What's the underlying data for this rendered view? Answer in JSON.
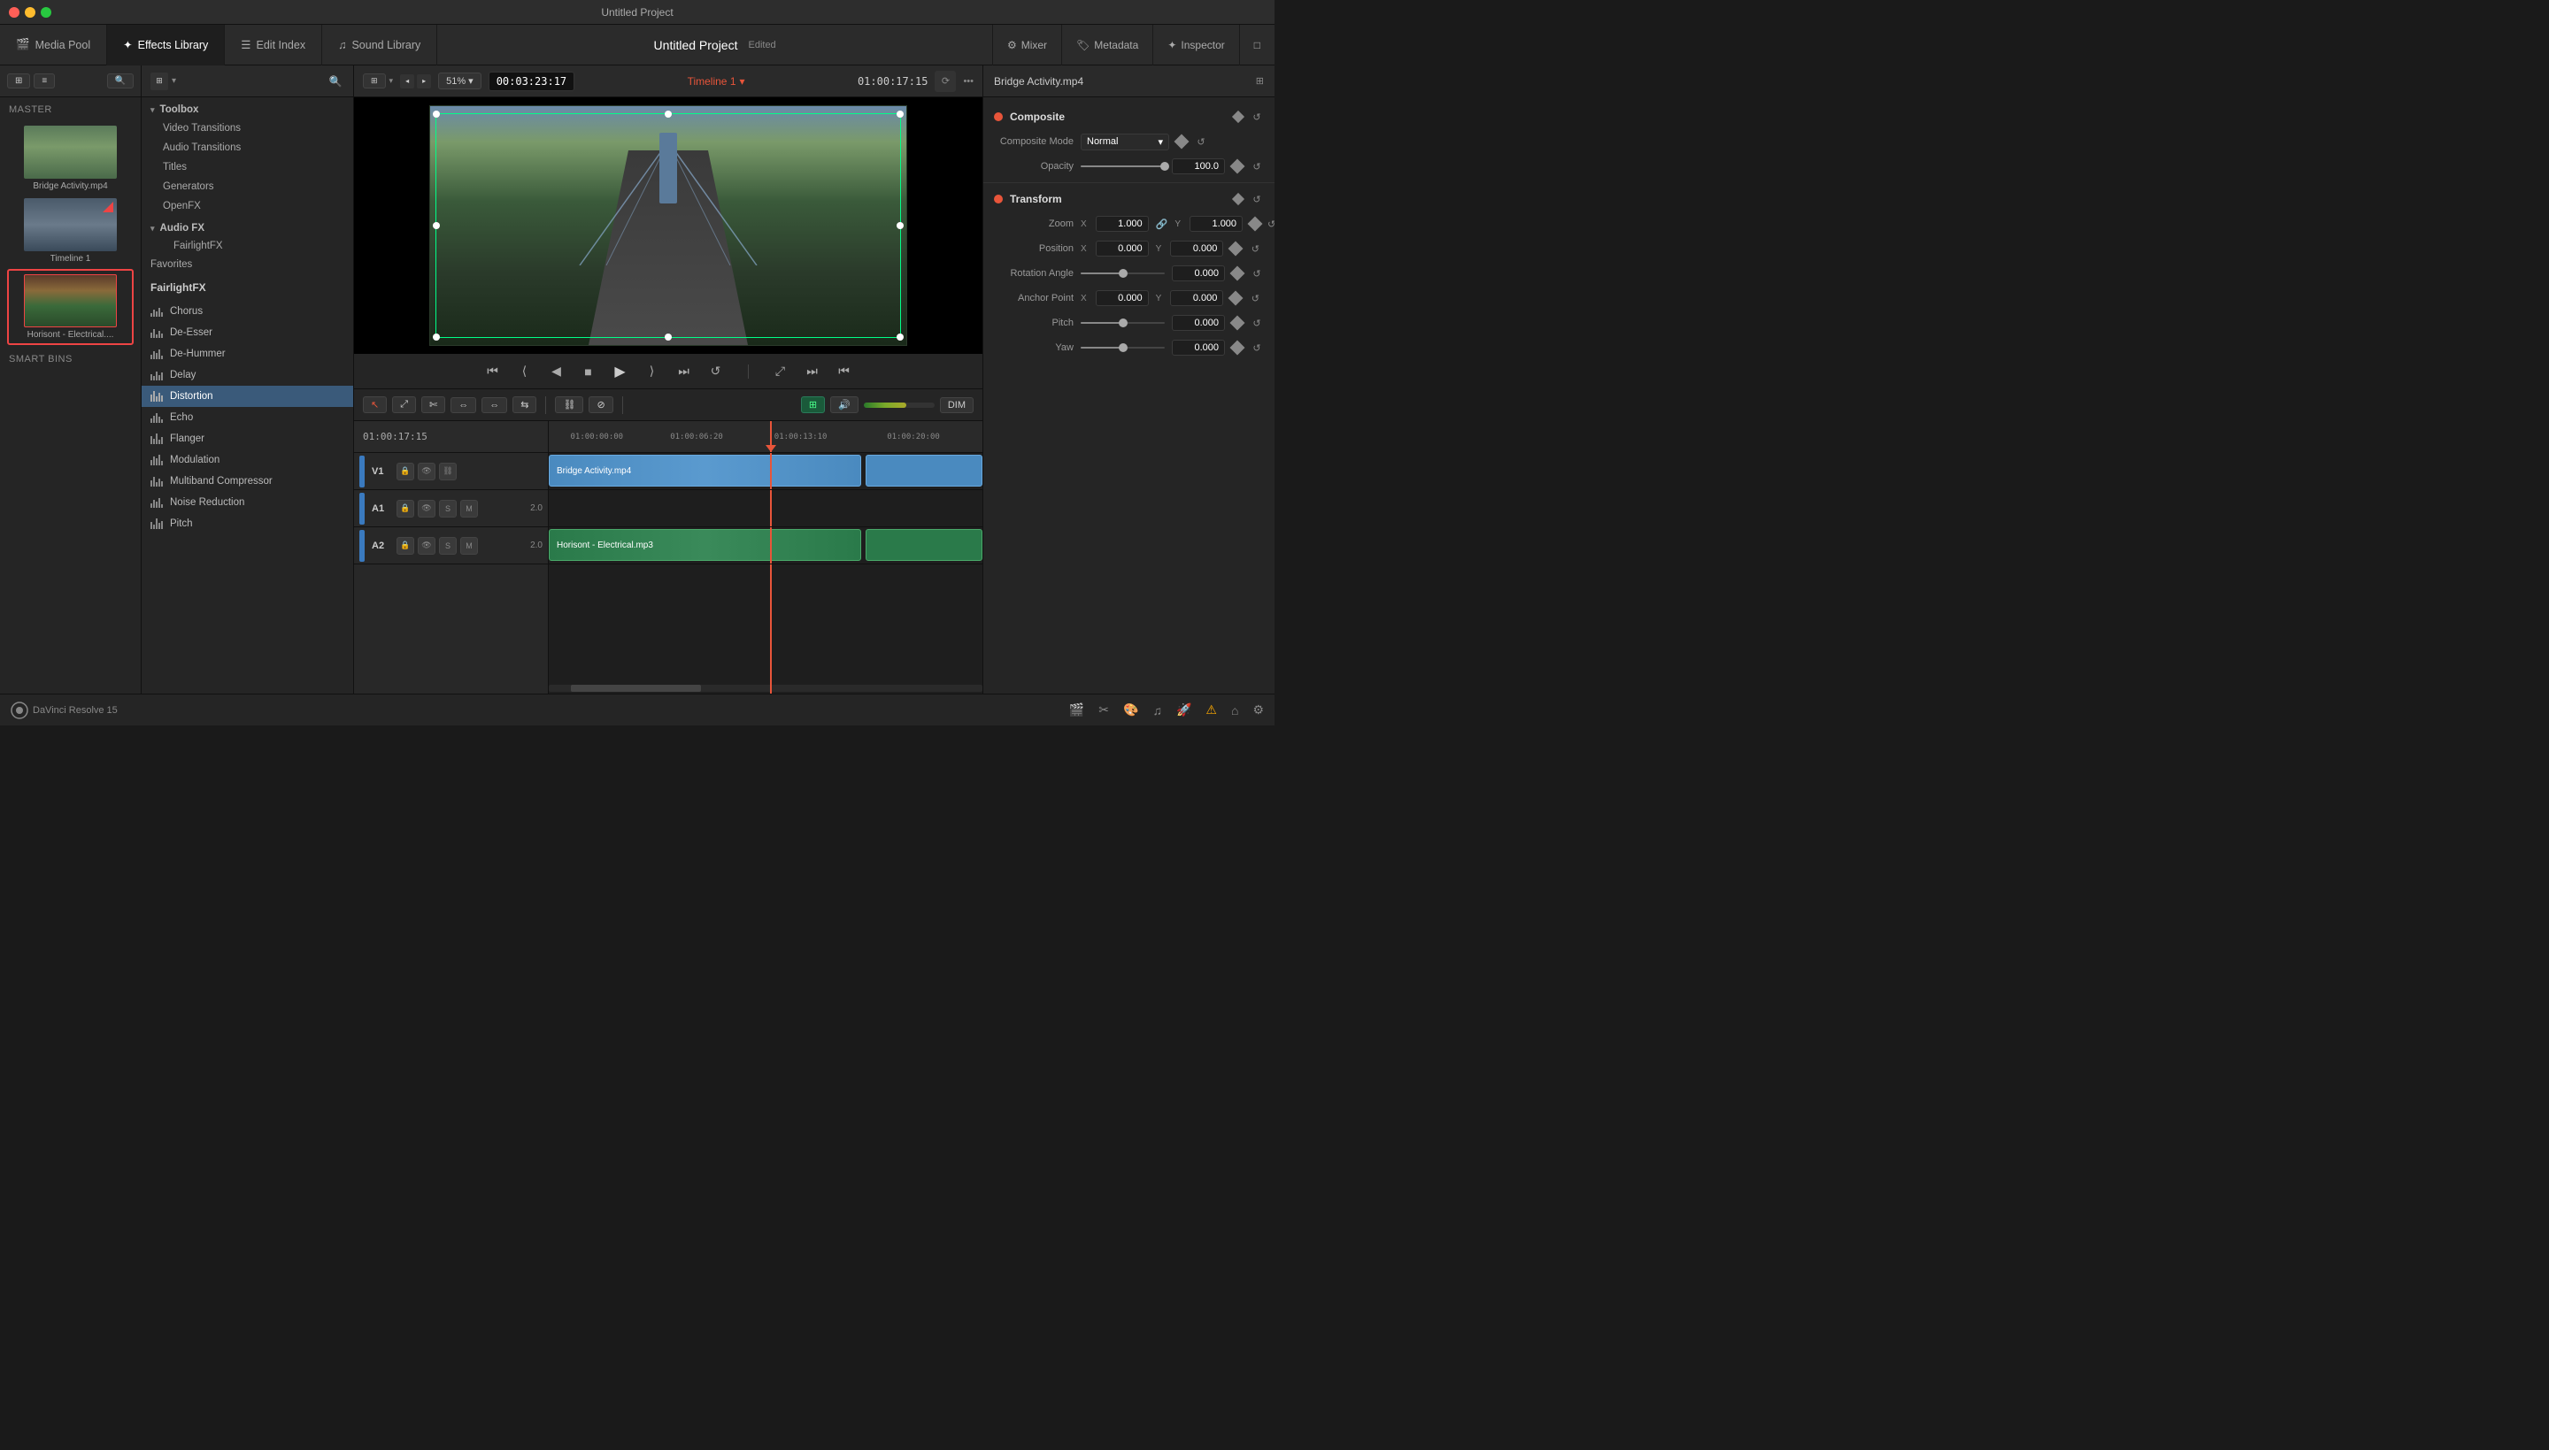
{
  "window": {
    "title": "Untitled Project"
  },
  "nav": {
    "tabs": [
      {
        "id": "media-pool",
        "icon": "🎬",
        "label": "Media Pool",
        "active": false
      },
      {
        "id": "effects-library",
        "icon": "✨",
        "label": "Effects Library",
        "active": true
      },
      {
        "id": "edit-index",
        "icon": "📋",
        "label": "Edit Index",
        "active": false
      },
      {
        "id": "sound-library",
        "icon": "🎵",
        "label": "Sound Library",
        "active": false
      }
    ],
    "project_title": "Untitled Project",
    "project_status": "Edited",
    "timeline_name": "Timeline 1",
    "actions": [
      {
        "id": "mixer",
        "label": "Mixer"
      },
      {
        "id": "metadata",
        "label": "Metadata"
      },
      {
        "id": "inspector",
        "label": "Inspector"
      }
    ]
  },
  "media_pool": {
    "master_label": "Master",
    "smart_bins_label": "Smart Bins",
    "items": [
      {
        "id": "bridge",
        "label": "Bridge Activity.mp4",
        "type": "video"
      },
      {
        "id": "timeline1",
        "label": "Timeline 1",
        "type": "timeline"
      },
      {
        "id": "horisont",
        "label": "Horisont - Electrical....",
        "type": "audio"
      }
    ]
  },
  "effects": {
    "panel_title": "FairlightFX",
    "toolbox": {
      "label": "Toolbox",
      "items": [
        {
          "id": "video-transitions",
          "label": "Video Transitions"
        },
        {
          "id": "audio-transitions",
          "label": "Audio Transitions"
        },
        {
          "id": "titles",
          "label": "Titles"
        },
        {
          "id": "generators",
          "label": "Generators"
        }
      ],
      "openfx_label": "OpenFX",
      "audio_fx_label": "Audio FX",
      "fairlightfx_label": "FairlightFX",
      "favorites_label": "Favorites"
    },
    "list": [
      {
        "id": "chorus",
        "label": "Chorus",
        "active": false
      },
      {
        "id": "de-esser",
        "label": "De-Esser",
        "active": false
      },
      {
        "id": "de-hummer",
        "label": "De-Hummer",
        "active": false
      },
      {
        "id": "delay",
        "label": "Delay",
        "active": false
      },
      {
        "id": "distortion",
        "label": "Distortion",
        "active": true
      },
      {
        "id": "echo",
        "label": "Echo",
        "active": false
      },
      {
        "id": "flanger",
        "label": "Flanger",
        "active": false
      },
      {
        "id": "modulation",
        "label": "Modulation",
        "active": false
      },
      {
        "id": "multiband-compressor",
        "label": "Multiband Compressor",
        "active": false
      },
      {
        "id": "noise-reduction",
        "label": "Noise Reduction",
        "active": false
      },
      {
        "id": "pitch",
        "label": "Pitch",
        "active": false
      }
    ]
  },
  "preview": {
    "zoom": "51%",
    "timecode": "00:03:23:17",
    "timeline_name": "Timeline 1",
    "duration": "01:00:17:15",
    "playhead_time": "01:00:17:15"
  },
  "timeline": {
    "time_markers": [
      "01:00:00:00",
      "01:00:06:20",
      "01:00:13:10",
      "01:00:20:00"
    ],
    "tracks": [
      {
        "id": "v1",
        "name": "V1",
        "type": "video",
        "clip_label": "Bridge Activity.mp4"
      },
      {
        "id": "a1",
        "name": "A1",
        "type": "audio",
        "volume": "2.0",
        "clip_label": ""
      },
      {
        "id": "a2",
        "name": "A2",
        "type": "audio",
        "volume": "2.0",
        "clip_label": "Horisont - Electrical.mp3"
      }
    ]
  },
  "inspector": {
    "file_name": "Bridge Activity.mp4",
    "composite": {
      "title": "Composite",
      "mode_label": "Composite Mode",
      "mode_value": "Normal",
      "opacity_label": "Opacity",
      "opacity_value": "100.0"
    },
    "transform": {
      "title": "Transform",
      "zoom_label": "Zoom",
      "zoom_x": "1.000",
      "zoom_y": "1.000",
      "position_label": "Position",
      "position_x": "0.000",
      "position_y": "0.000",
      "rotation_label": "Rotation Angle",
      "rotation_value": "0.000",
      "anchor_label": "Anchor Point",
      "anchor_x": "0.000",
      "anchor_y": "0.000",
      "pitch_label": "Pitch",
      "pitch_value": "0.000",
      "yaw_label": "Yaw",
      "yaw_value": "0.000"
    }
  },
  "status_bar": {
    "logo": "DaVinci Resolve 15"
  }
}
